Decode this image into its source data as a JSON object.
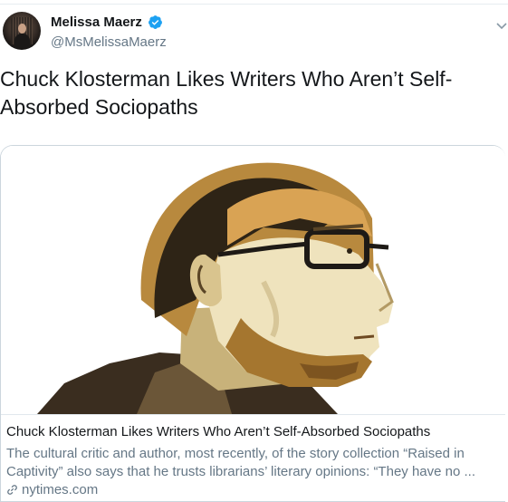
{
  "tweet": {
    "author": {
      "display_name": "Melissa Maerz",
      "handle": "@MsMelissaMaerz",
      "verified": true
    },
    "text": "Chuck Klosterman Likes Writers Who Aren’t Self-\nAbsorbed Sociopaths",
    "card": {
      "title": "Chuck Klosterman Likes Writers Who Aren’t Self-Absorbed Sociopaths",
      "description": "The cultural critic and author, most recently, of the story collection “Raised in Captivity” also says that he trusts librarians’ literary opinions: “They have no ...",
      "domain": "nytimes.com",
      "image_subject": "illustrated portrait of a bearded man with glasses in profile"
    }
  },
  "colors": {
    "verified_blue": "#1da1f2",
    "secondary_text": "#657786",
    "card_border": "#ccd6dd"
  },
  "icons": {
    "verified": "verified-badge-icon",
    "caret": "chevron-down-icon",
    "link": "link-icon"
  }
}
